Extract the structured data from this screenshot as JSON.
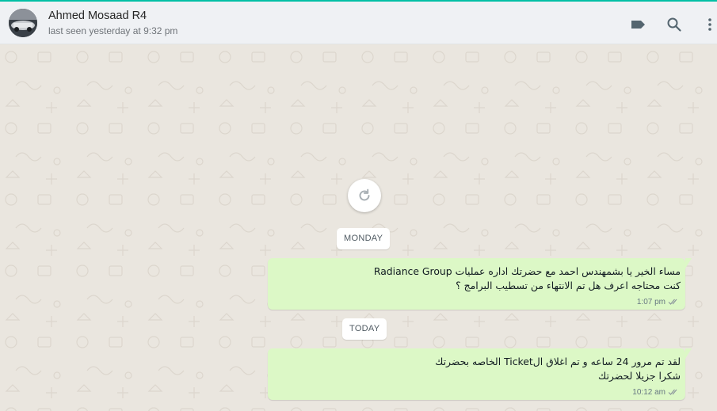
{
  "contact": {
    "name": "Ahmed Mosaad R4",
    "status": "last seen yesterday at 9:32 pm"
  },
  "header_icons": [
    "label-icon",
    "search-icon",
    "more-options-icon"
  ],
  "chat": {
    "refresh_icon": "refresh-icon",
    "dividers": [
      "MONDAY",
      "TODAY"
    ],
    "messages": [
      {
        "lines": [
          "مساء الخير يا بشمهندس احمد مع حضرتك اداره عمليات Radiance Group",
          "كنت محتاجه اعرف هل تم الانتهاء من تسطيب البرامج ؟"
        ],
        "time": "1:07 pm",
        "status": "read"
      },
      {
        "lines": [
          "لقد تم مرور 24 ساعه و تم اغلاق الTicket الخاصه بحضرتك",
          "شكرا جزيلا لحضرتك"
        ],
        "time": "10:12 am",
        "status": "read"
      }
    ]
  },
  "colors": {
    "accent": "#00bfa5",
    "outgoing_bubble": "#dcf8c6",
    "chat_background": "#eae6df",
    "header_background": "#eff1f4"
  }
}
